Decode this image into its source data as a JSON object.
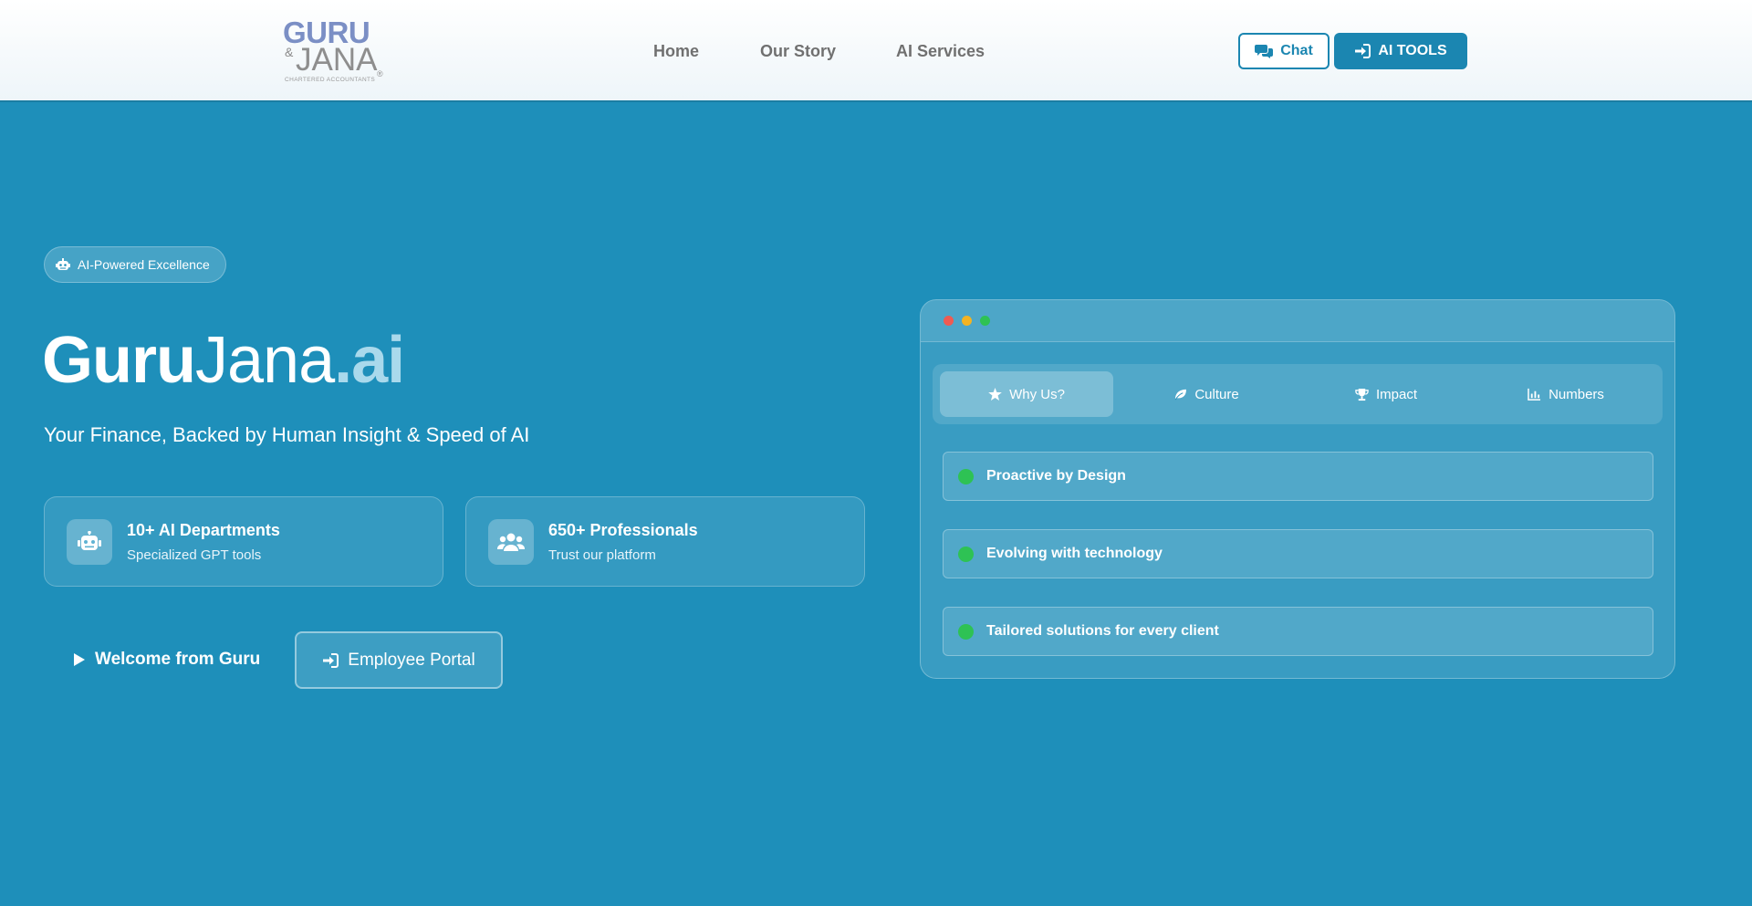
{
  "header": {
    "logo": {
      "line1": "GURU",
      "amp": "&",
      "line2": "JANA",
      "tagline": "CHARTERED ACCOUNTANTS",
      "reg": "®"
    },
    "nav": [
      {
        "label": "Home"
      },
      {
        "label": "Our Story"
      },
      {
        "label": "AI Services"
      }
    ],
    "chat_label": "Chat",
    "tools_label": "AI TOOLS"
  },
  "hero": {
    "badge": "AI-Powered Excellence",
    "title_part1": "Guru",
    "title_part2": "Jana",
    "title_part3": ".ai",
    "subtitle": "Your Finance, Backed by Human Insight & Speed of AI",
    "stats": [
      {
        "title": "10+ AI Departments",
        "desc": "Specialized GPT tools",
        "icon": "robot-icon"
      },
      {
        "title": "650+ Professionals",
        "desc": "Trust our platform",
        "icon": "users-icon"
      }
    ],
    "welcome_label": "Welcome from Guru",
    "portal_label": "Employee Portal"
  },
  "panel": {
    "tabs": [
      {
        "label": "Why Us?",
        "icon": "star-icon",
        "active": true
      },
      {
        "label": "Culture",
        "icon": "leaf-icon",
        "active": false
      },
      {
        "label": "Impact",
        "icon": "trophy-icon",
        "active": false
      },
      {
        "label": "Numbers",
        "icon": "chart-icon",
        "active": false
      }
    ],
    "items": [
      {
        "label": "Proactive by Design"
      },
      {
        "label": "Evolving with technology"
      },
      {
        "label": "Tailored solutions for every client"
      }
    ]
  },
  "colors": {
    "background": "#1e8fba",
    "accent": "#1b86b1",
    "ai_highlight": "#a9d9ec",
    "bullet_green": "#2ec254",
    "dot_red": "#ef5b52",
    "dot_yellow": "#f3b322",
    "dot_green": "#2ec254"
  }
}
